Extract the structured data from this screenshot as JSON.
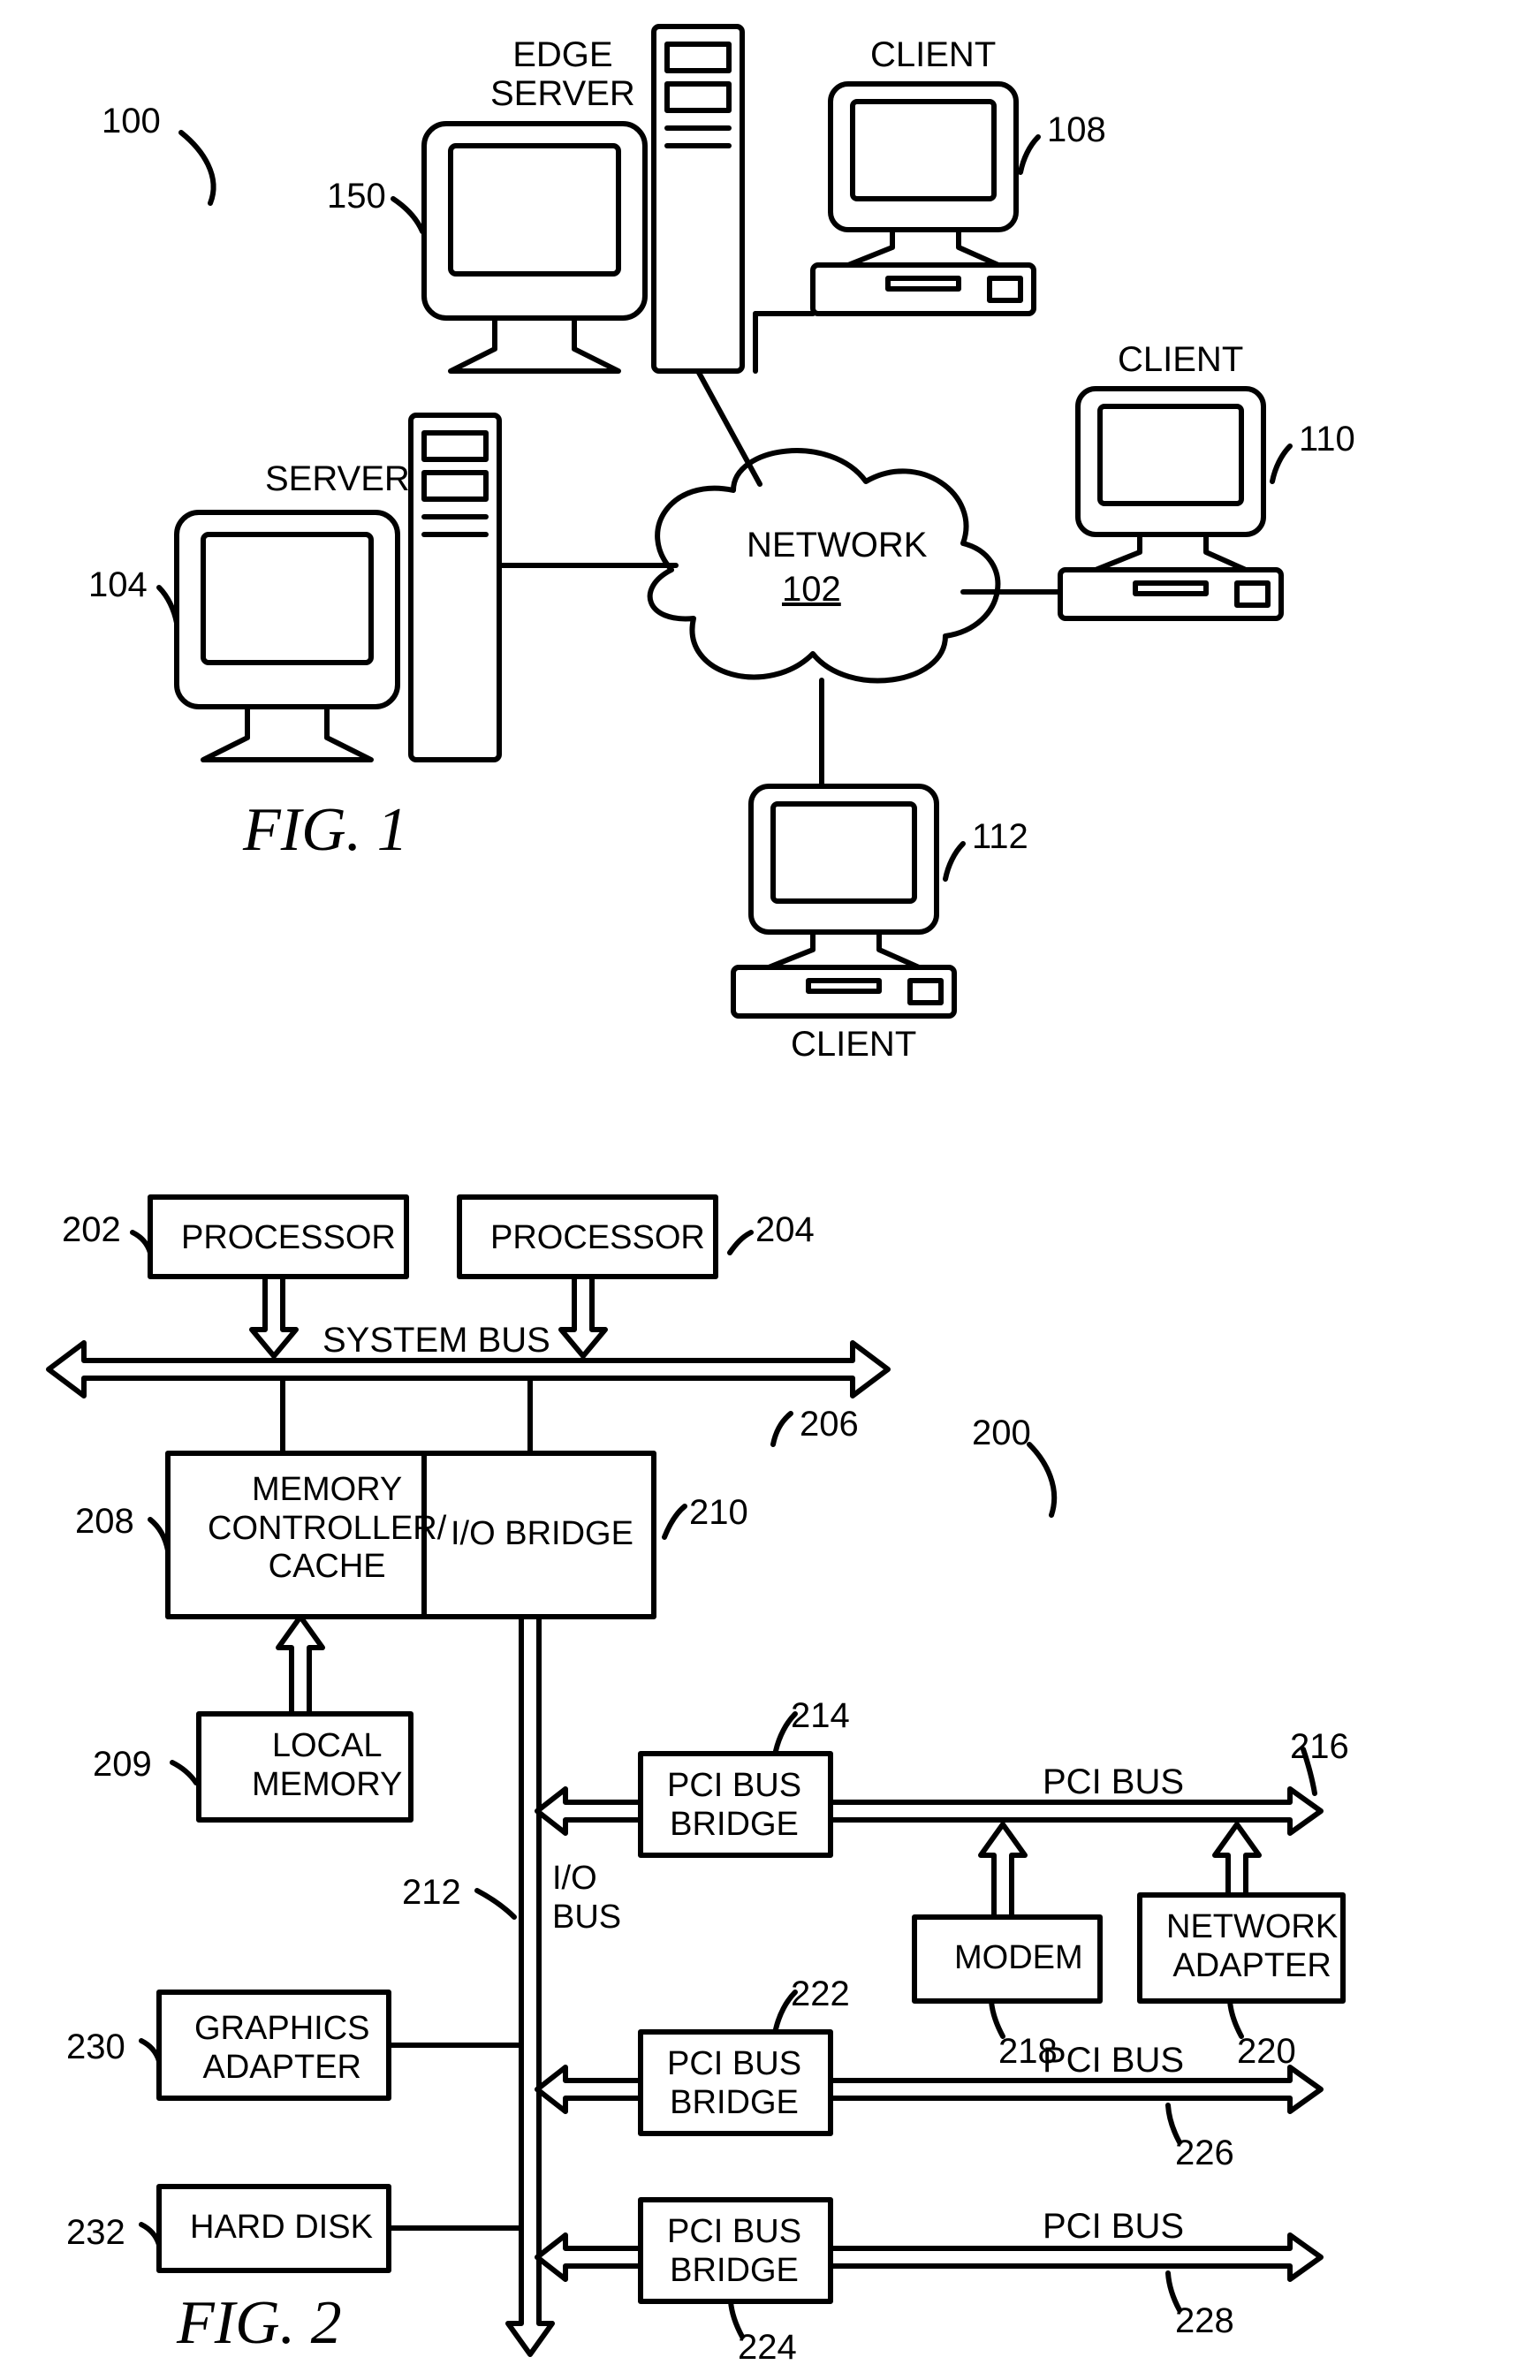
{
  "fig1": {
    "caption": "FIG.  1",
    "ref_sys": "100",
    "network_label": "NETWORK",
    "network_ref": "102",
    "edge_server_label": "EDGE\nSERVER",
    "edge_server_ref": "150",
    "client_label": "CLIENT",
    "client1_ref": "108",
    "client2_ref": "110",
    "client3_ref": "112",
    "server_label": "SERVER",
    "server_ref": "104"
  },
  "fig2": {
    "caption": "FIG.  2",
    "ref_sys": "200",
    "processor": "PROCESSOR",
    "proc1_ref": "202",
    "proc2_ref": "204",
    "system_bus": "SYSTEM BUS",
    "system_bus_ref": "206",
    "mem_ctrl": "MEMORY\nCONTROLLER/\nCACHE",
    "mem_ctrl_ref": "208",
    "io_bridge": "I/O BRIDGE",
    "io_bridge_ref": "210",
    "local_mem": "LOCAL\nMEMORY",
    "local_mem_ref": "209",
    "io_bus": "I/O\nBUS",
    "io_bus_ref": "212",
    "pci_bridge": "PCI BUS\nBRIDGE",
    "pci1_ref": "214",
    "pci_bus": "PCI BUS",
    "pci_bus1_ref": "216",
    "modem": "MODEM",
    "modem_ref": "218",
    "net_adapter": "NETWORK\nADAPTER",
    "net_adapter_ref": "220",
    "pci2_ref": "222",
    "pci_bus2_ref": "226",
    "pci3_ref": "224",
    "pci_bus3_ref": "228",
    "graphics": "GRAPHICS\nADAPTER",
    "graphics_ref": "230",
    "hard_disk": "HARD DISK",
    "hard_disk_ref": "232"
  }
}
